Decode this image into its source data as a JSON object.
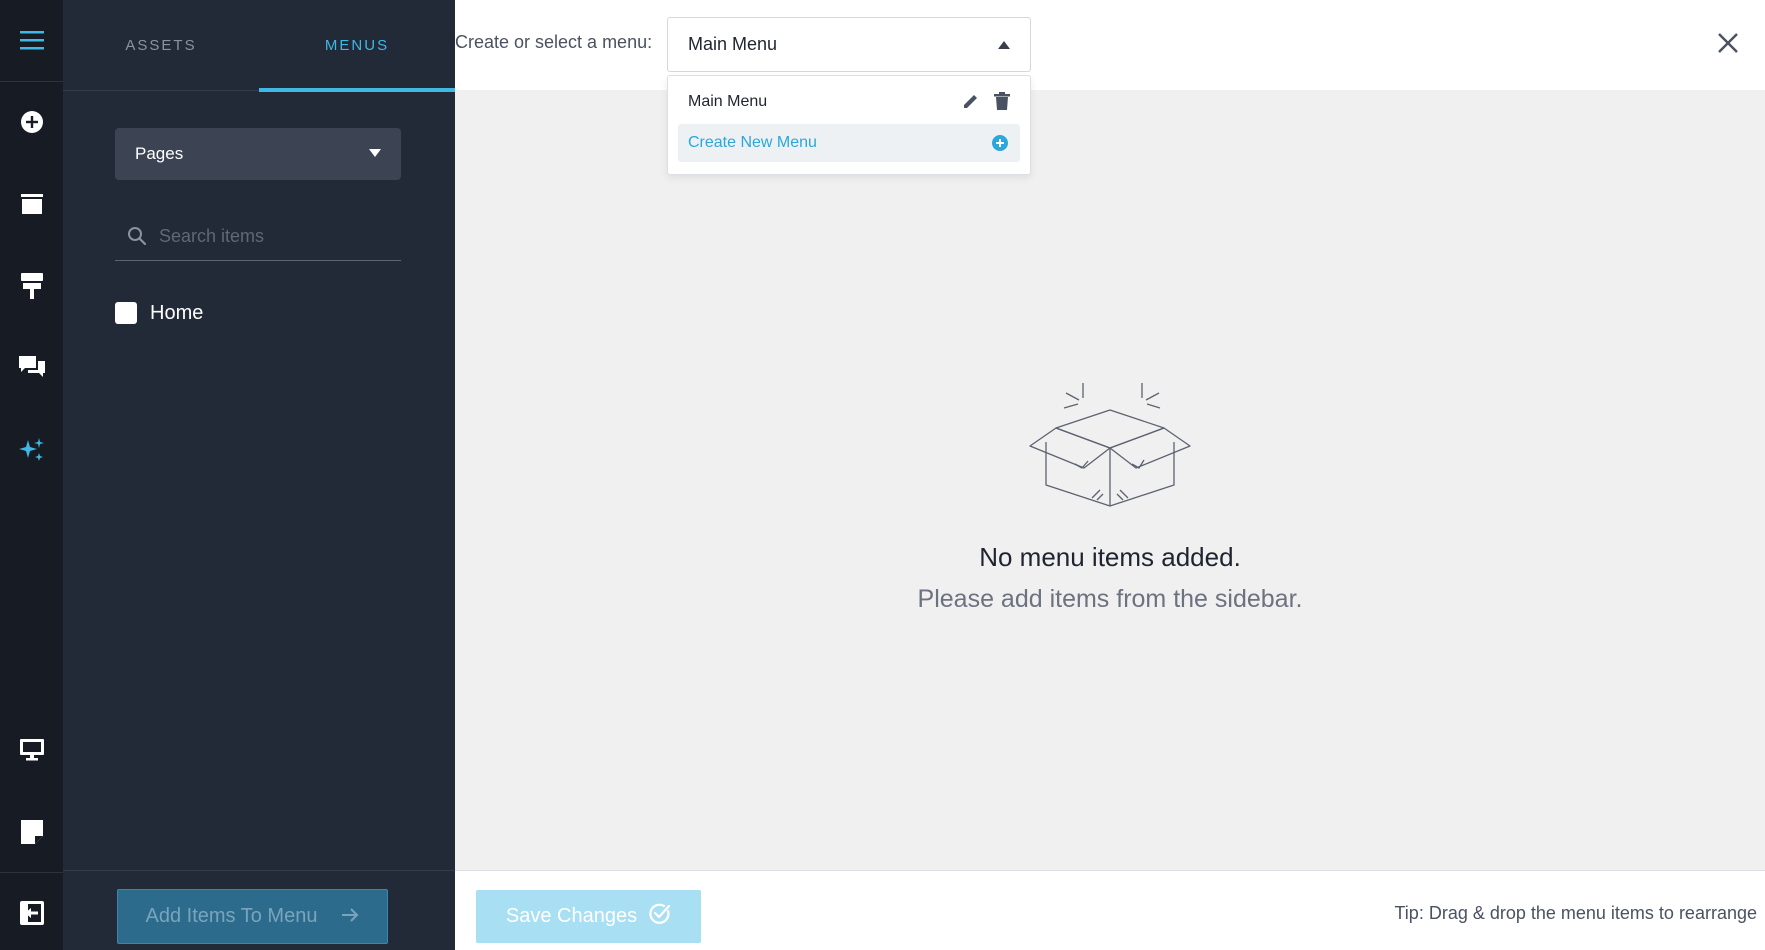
{
  "rail": {
    "icons": [
      "hamburger-menu-icon",
      "add-circle-icon",
      "window-icon",
      "paint-roller-icon",
      "chat-bubbles-icon",
      "sparkles-icon",
      "desktop-monitor-icon",
      "sticky-note-icon",
      "exit-icon"
    ],
    "accent": "#3fb8e6"
  },
  "sidebar": {
    "tabs": [
      {
        "label": "ASSETS"
      },
      {
        "label": "MENUS"
      }
    ],
    "pages_select": {
      "value": "Pages"
    },
    "search": {
      "placeholder": "Search items"
    },
    "items": [
      {
        "label": "Home",
        "checked": false
      }
    ],
    "add_button": {
      "label": "Add Items To Menu"
    }
  },
  "topbar": {
    "label": "Create or select a menu:",
    "selected_menu": "Main Menu"
  },
  "dropdown": {
    "options": [
      {
        "label": "Main Menu"
      },
      {
        "label": "Create New Menu"
      }
    ]
  },
  "empty_state": {
    "title": "No menu items added.",
    "subtitle": "Please add items from the sidebar."
  },
  "footer": {
    "save_label": "Save Changes",
    "tip": "Tip: Drag & drop the menu items to rearrange"
  }
}
